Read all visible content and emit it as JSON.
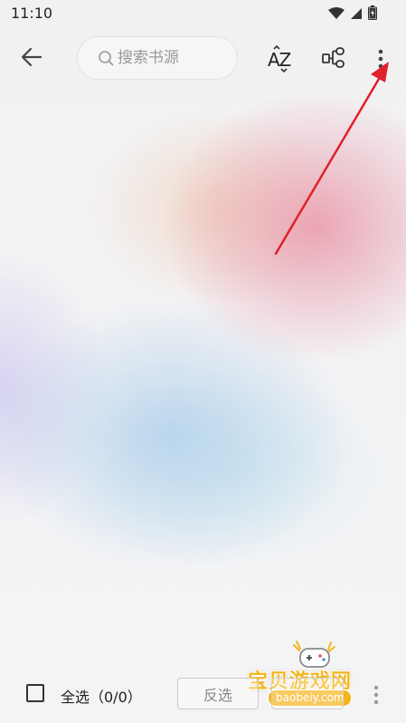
{
  "status_bar": {
    "time": "11:10",
    "icons": [
      "wifi-icon",
      "signal-icon",
      "battery-charging-icon"
    ]
  },
  "toolbar": {
    "back_icon": "arrow-left-icon",
    "search": {
      "placeholder": "搜索书源",
      "value": ""
    },
    "sort_label": "AZ",
    "group_icon": "group-icon",
    "more_icon": "more-vertical-icon"
  },
  "annotation": {
    "color": "#e0202a"
  },
  "bottom_bar": {
    "select_all_label": "全选（0/0）",
    "select_all_checked": false,
    "invert_label": "反选",
    "more_icon": "more-vertical-icon"
  },
  "watermark": {
    "title": "宝贝游戏网",
    "url": "baobeiy.com",
    "color": "#f2b71f"
  }
}
